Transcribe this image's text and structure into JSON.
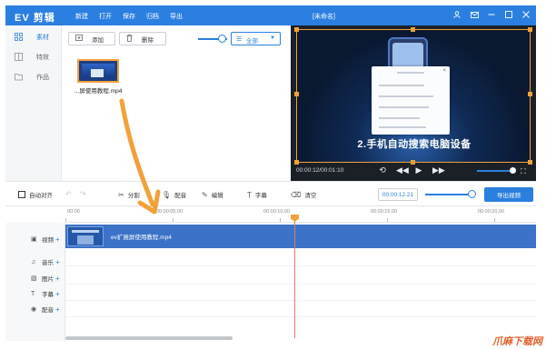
{
  "app": {
    "logo": "EV 剪辑",
    "menu": [
      "新建",
      "打开",
      "保存",
      "归档",
      "导出"
    ],
    "title": "[未命名]"
  },
  "sidebar": {
    "items": [
      {
        "label": "素材",
        "icon": "grid-icon",
        "active": true
      },
      {
        "label": "特效",
        "icon": "fx-icon",
        "active": false
      },
      {
        "label": "作品",
        "icon": "folder-icon",
        "active": false
      }
    ]
  },
  "media": {
    "add_label": "添加",
    "delete_label": "删除",
    "filter_value": "全部",
    "thumb_name": "...屏使用教程.mp4"
  },
  "preview": {
    "caption": "2.手机自动搜索电脑设备",
    "time": "00:00:12/00:01:10",
    "volume_fraction": 0.95
  },
  "toolbar": {
    "auto_align": "自动对齐",
    "split": "分割",
    "dub": "配音",
    "edit": "编辑",
    "subtitle": "字幕",
    "clear": "清空",
    "timecode": "00:00:12.21",
    "export": "导出视频"
  },
  "timeline": {
    "ruler": [
      "00:00",
      "00:00:05.00",
      "00:00:10.00",
      "00:00:15.00",
      "00:00:20.00"
    ],
    "tracks": [
      {
        "label": "视频",
        "icon": "video-icon"
      },
      {
        "label": "音乐",
        "icon": "music-icon"
      },
      {
        "label": "图片",
        "icon": "image-icon"
      },
      {
        "label": "字幕",
        "icon": "text-icon"
      },
      {
        "label": "配音",
        "icon": "mic-icon"
      }
    ],
    "clip_name": "ev扩展屏使用教程.mp4"
  },
  "watermark": "爪麻下载网",
  "colors": {
    "accent": "#2b7fe0",
    "highlight": "#f2a13a",
    "playhead": "#e37b5a"
  }
}
